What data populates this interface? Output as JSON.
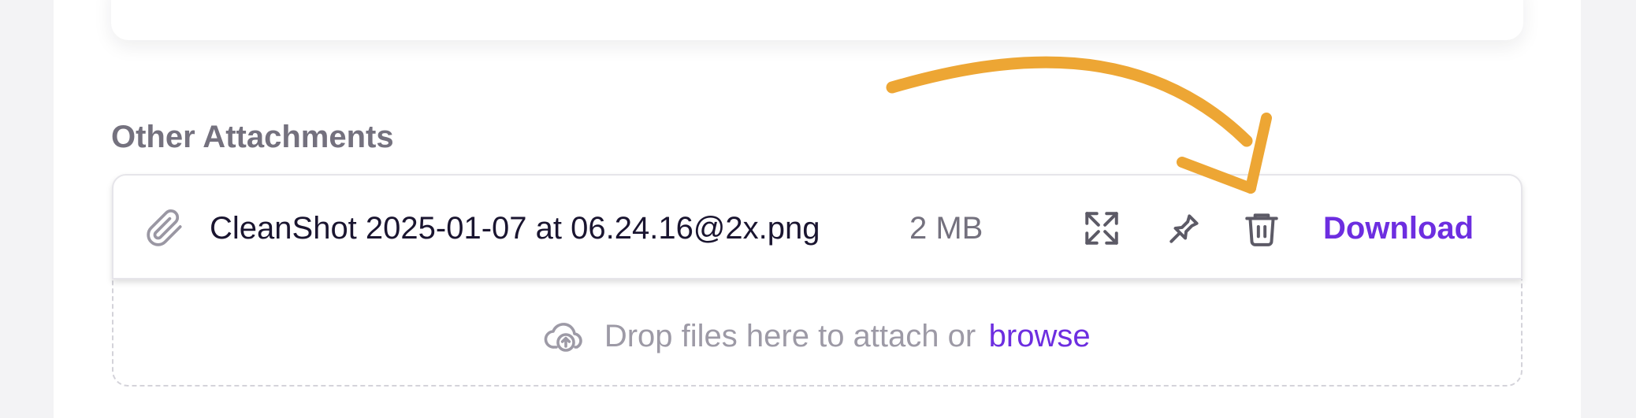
{
  "section": {
    "title": "Other Attachments"
  },
  "attachment": {
    "file_name": "CleanShot 2025-01-07 at 06.24.16@2x.png",
    "file_size": "2 MB",
    "download_label": "Download"
  },
  "dropzone": {
    "text": "Drop files here to attach or",
    "browse_label": "browse"
  },
  "icons": {
    "attachment": "paperclip-icon",
    "expand": "expand-icon",
    "pin": "pin-icon",
    "delete": "trash-icon",
    "upload": "cloud-upload-icon",
    "annotation": "annotation-arrow"
  },
  "colors": {
    "accent": "#6d2ee0",
    "arrow": "#eda634",
    "muted_text": "#9d9aa6",
    "primary_text": "#1a1530",
    "heading": "#74717e"
  }
}
